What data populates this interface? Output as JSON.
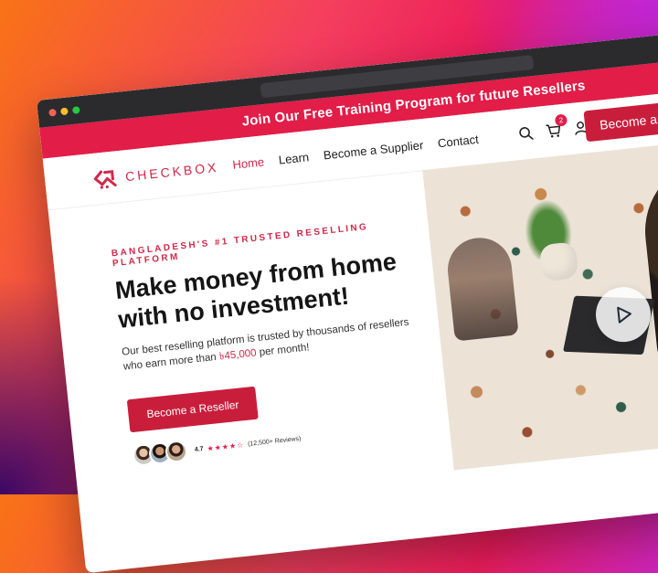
{
  "colors": {
    "brand": "#d1284a",
    "brand_dark": "#c81e3c",
    "announce_bg": "#e11d48",
    "titlebar": "#2b2b2e"
  },
  "announcement": {
    "text": "Join Our Free Training Program for future Resellers"
  },
  "nav": {
    "logo_text": "CHECKBOX",
    "links": [
      "Home",
      "Learn",
      "Become a Supplier",
      "Contact"
    ],
    "active_link": "Home",
    "cart_count": "2",
    "cta_label": "Become a Reseller",
    "icons": [
      "search-icon",
      "cart-icon",
      "user-icon"
    ]
  },
  "hero": {
    "tagline": "BANGLADESH'S #1 TRUSTED RESELLING PLATFORM",
    "headline_line1": "Make money from home",
    "headline_line2": "with no investment!",
    "sub_text_1": "Our best reselling platform is trusted by thousands of resellers",
    "sub_text_2": "who earn more than ",
    "sub_highlight": "৳45,000",
    "sub_text_3": " per month!",
    "button_label": "Become a Reseller",
    "rating": "4.7",
    "stars": "★★★★☆",
    "reviews_count": "(12,500+ Reviews)"
  },
  "media": {
    "icon": "play-icon"
  }
}
